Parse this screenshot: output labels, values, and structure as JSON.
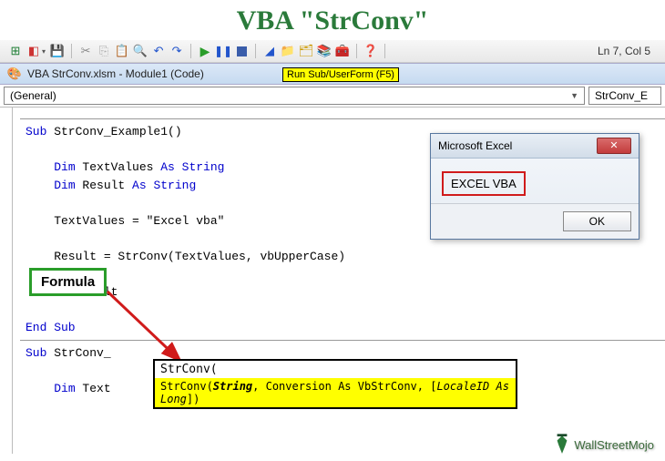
{
  "page_title": "VBA \"StrConv\"",
  "status": "Ln 7, Col 5",
  "window_title": "VBA StrConv.xlsm - Module1 (Code)",
  "run_label": "Run Sub/UserForm (F5)",
  "dropdown_left": "(General)",
  "dropdown_right": "StrConv_E",
  "code": {
    "l1a": "Sub",
    "l1b": " StrConv_Example1()",
    "l2a": "Dim",
    "l2b": " TextValues ",
    "l2c": "As String",
    "l3a": "Dim",
    "l3b": " Result ",
    "l3c": "As String",
    "l4": "    TextValues = \"Excel vba\"",
    "l5": "    Result = StrConv(TextValues, vbUpperCase)",
    "l6": "         sult",
    "l7": "End Sub",
    "l8a": "Sub",
    "l8b": " StrConv_",
    "l9a": "Dim",
    "l9b": " Text"
  },
  "formula_label": "Formula",
  "tooltip_top": "StrConv(",
  "tooltip_fn": "StrConv(",
  "tooltip_arg1": "String",
  "tooltip_mid": ", Conversion As VbStrConv, [",
  "tooltip_arg2": "LocaleID As Long",
  "tooltip_end": "])",
  "msgbox": {
    "title": "Microsoft Excel",
    "text": "EXCEL VBA",
    "button": "OK"
  },
  "watermark": "WallStreetMojo"
}
